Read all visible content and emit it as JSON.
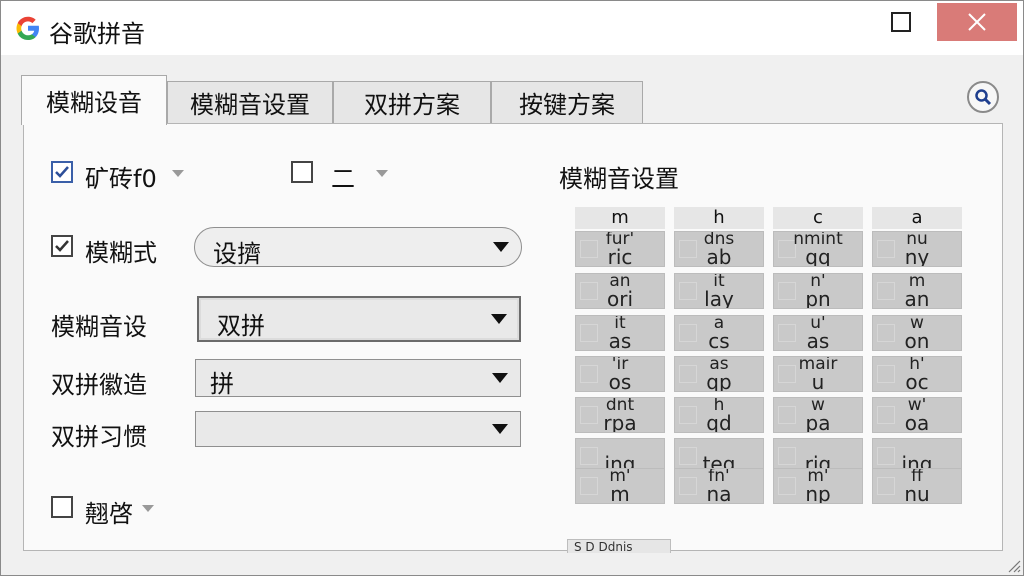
{
  "window": {
    "title": "谷歌拼音",
    "icon": "google-g-icon",
    "controls": [
      "maximize-icon",
      "close-icon"
    ]
  },
  "tabs": [
    {
      "label": "模糊设音",
      "active": true
    },
    {
      "label": "模糊音设置",
      "active": false
    },
    {
      "label": "双拼方案",
      "active": false
    },
    {
      "label": "按键方案",
      "active": false
    }
  ],
  "search_icon": "search-icon",
  "options": {
    "option1": {
      "label": "矿砖f0",
      "checked": true
    },
    "option2": {
      "label": "二",
      "checked": false
    },
    "option3": {
      "label": "模糊式",
      "checked": true,
      "value": "设擠"
    },
    "row1": {
      "label": "模糊音设",
      "value": "双拼"
    },
    "row2": {
      "label": "双拼徽造",
      "value": "拼"
    },
    "row3": {
      "label": "双拼习惯",
      "value": ""
    },
    "option4": {
      "label": "翹啓",
      "checked": false
    }
  },
  "fuzzy_grid": {
    "title": "模糊音设置",
    "headers": [
      "m",
      "h",
      "c",
      "a"
    ],
    "rows": [
      [
        {
          "top": "fur'",
          "bottom": "ric"
        },
        {
          "top": "dns",
          "bottom": "ab"
        },
        {
          "top": "nmint",
          "bottom": "qq"
        },
        {
          "top": "nu",
          "bottom": "ny"
        }
      ],
      [
        {
          "top": "an",
          "bottom": "ori"
        },
        {
          "top": "it",
          "bottom": "lay"
        },
        {
          "top": "n'",
          "bottom": "pn"
        },
        {
          "top": "m",
          "bottom": "an"
        }
      ],
      [
        {
          "top": "it",
          "bottom": "as"
        },
        {
          "top": "a",
          "bottom": "cs"
        },
        {
          "top": "u'",
          "bottom": "as"
        },
        {
          "top": "w",
          "bottom": "on"
        }
      ],
      [
        {
          "top": "'ir",
          "bottom": "os"
        },
        {
          "top": "as",
          "bottom": "qp"
        },
        {
          "top": "mair",
          "bottom": "u"
        },
        {
          "top": "h'",
          "bottom": "oc"
        }
      ],
      [
        {
          "top": "dnt",
          "bottom": "rpa"
        },
        {
          "top": "h",
          "bottom": "qd"
        },
        {
          "top": "w",
          "bottom": "pa"
        },
        {
          "top": "w'",
          "bottom": "oa"
        }
      ],
      [
        {
          "top": "",
          "bottom": "ing"
        },
        {
          "top": "",
          "bottom": "teg"
        },
        {
          "top": "",
          "bottom": "rig"
        },
        {
          "top": "",
          "bottom": "ing"
        }
      ],
      [
        {
          "top": "m'",
          "bottom": "m"
        },
        {
          "top": "fn'",
          "bottom": "na"
        },
        {
          "top": "m'",
          "bottom": "np"
        },
        {
          "top": "ff",
          "bottom": "nu"
        }
      ]
    ]
  },
  "bottom_tab": "S D Ddnis",
  "colors": {
    "close_button": "#d97b78",
    "checkbox_accent": "#3a5fa8",
    "panel": "#fafafa",
    "cell": "#c9c9c9"
  }
}
